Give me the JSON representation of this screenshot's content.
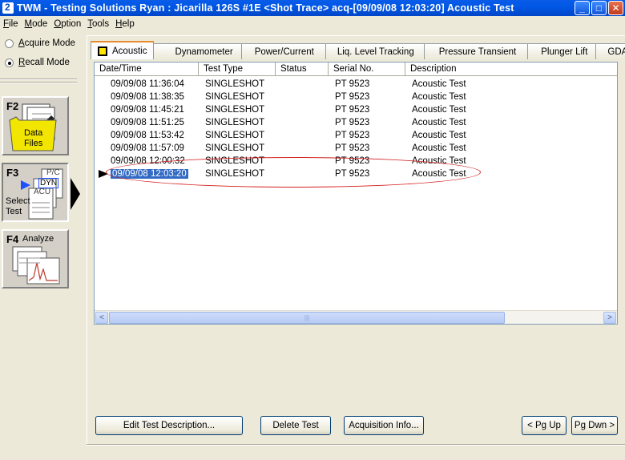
{
  "window": {
    "title": "TWM  -  Testing Solutions Ryan : Jicarilla 126S #1E  <Shot Trace>  acq-[09/09/08 12:03:20]  Acoustic Test",
    "controls": {
      "minimize": "_",
      "maximize": "□",
      "close": "✕"
    }
  },
  "menu": [
    {
      "label_ul": "F",
      "label_rest": "ile"
    },
    {
      "label_ul": "M",
      "label_rest": "ode"
    },
    {
      "label_ul": "O",
      "label_rest": "ption"
    },
    {
      "label_ul": "T",
      "label_rest": "ools"
    },
    {
      "label_ul": "H",
      "label_rest": "elp"
    }
  ],
  "mode": {
    "acquire": {
      "ul": "A",
      "rest": "cquire Mode",
      "selected": false
    },
    "recall": {
      "ul": "R",
      "rest": "ecall Mode",
      "selected": true
    }
  },
  "fkeys": {
    "f2": {
      "key": "F2",
      "line1": "Data",
      "line2": "Files"
    },
    "f3": {
      "key": "F3",
      "line1": "Select",
      "line2": "Test",
      "doc_labels": [
        "P/C",
        "DYN",
        "ACU"
      ]
    },
    "f4": {
      "key": "F4",
      "line1": "Analyze"
    }
  },
  "tabs": [
    "Acoustic",
    "Dynamometer",
    "Power/Current",
    "Liq. Level Tracking",
    "Pressure Transient",
    "Plunger Lift",
    "GDA"
  ],
  "table": {
    "columns": [
      "Date/Time",
      "Test Type",
      "Status",
      "Serial No.",
      "Description"
    ],
    "rows": [
      [
        "09/09/08 11:36:04",
        "SINGLESHOT",
        "",
        "PT 9523",
        "Acoustic Test"
      ],
      [
        "09/09/08 11:38:35",
        "SINGLESHOT",
        "",
        "PT 9523",
        "Acoustic Test"
      ],
      [
        "09/09/08 11:45:21",
        "SINGLESHOT",
        "",
        "PT 9523",
        "Acoustic Test"
      ],
      [
        "09/09/08 11:51:25",
        "SINGLESHOT",
        "",
        "PT 9523",
        "Acoustic Test"
      ],
      [
        "09/09/08 11:53:42",
        "SINGLESHOT",
        "",
        "PT 9523",
        "Acoustic Test"
      ],
      [
        "09/09/08 11:57:09",
        "SINGLESHOT",
        "",
        "PT 9523",
        "Acoustic Test"
      ],
      [
        "09/09/08 12:00:32",
        "SINGLESHOT",
        "",
        "PT 9523",
        "Acoustic Test"
      ],
      [
        "09/09/08 12:03:20",
        "SINGLESHOT",
        "",
        "PT 9523",
        "Acoustic Test"
      ]
    ],
    "selected_index": 7
  },
  "scrollbar": {
    "left": "<",
    "right": ">",
    "grip": "|||"
  },
  "buttons": {
    "edit": "Edit Test Description...",
    "delete": "Delete Test",
    "acq_info": "Acquisition Info...",
    "pg_up": "< Pg Up",
    "pg_dwn": "Pg Dwn >"
  },
  "colors": {
    "title_bar": "#0058e6",
    "selection": "#316ac5",
    "annotation_oval": "#d42020",
    "active_tab_icon": "#ffe600"
  }
}
